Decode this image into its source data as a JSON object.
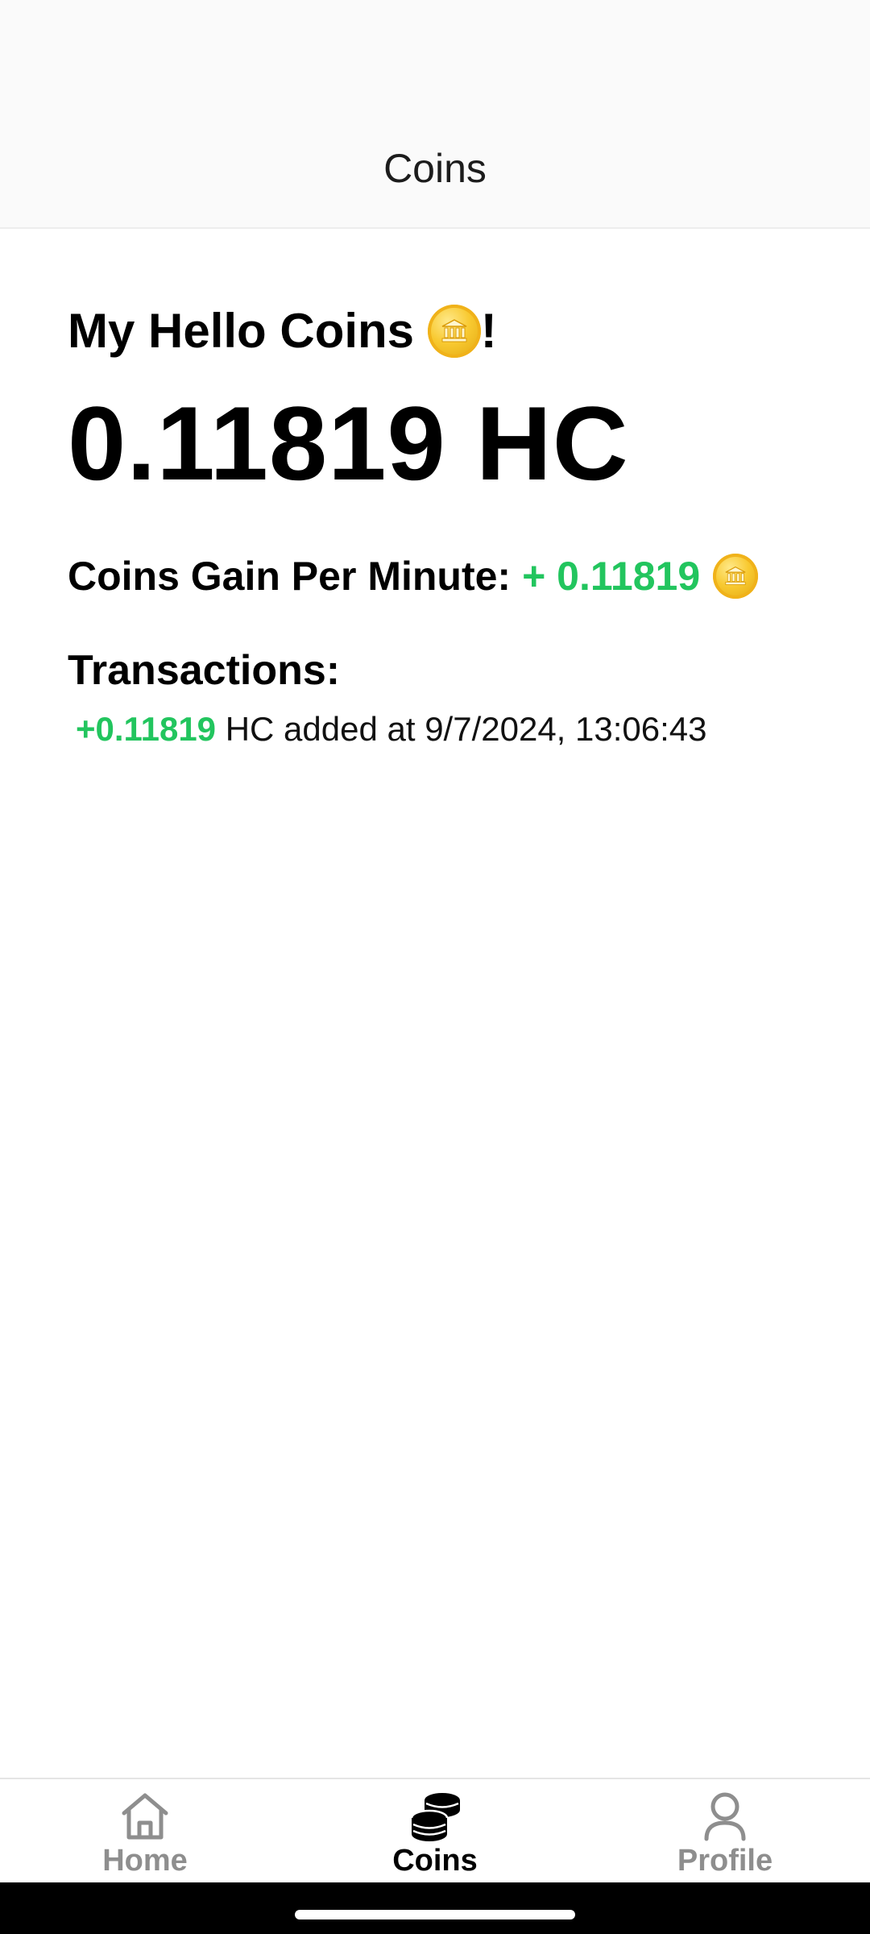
{
  "header": {
    "title": "Coins"
  },
  "main": {
    "heading_text": "My Hello Coins ",
    "heading_suffix": "!",
    "coin_icon": "coin-bank-emoji",
    "balance": "0.11819 HC",
    "gain_label": "Coins Gain Per Minute:",
    "gain_value": "+ 0.11819",
    "transactions_heading": "Transactions:",
    "transactions": [
      {
        "amount": "+0.11819",
        "text": " HC added at 9/7/2024, 13:06:43"
      }
    ]
  },
  "tabbar": {
    "tabs": [
      {
        "label": "Home",
        "icon": "home-icon",
        "active": false
      },
      {
        "label": "Coins",
        "icon": "coins-stack-icon",
        "active": true
      },
      {
        "label": "Profile",
        "icon": "profile-icon",
        "active": false
      }
    ]
  },
  "colors": {
    "accent_green": "#22c55e",
    "inactive_tab": "#8e8e8e",
    "active_tab": "#000000",
    "coin_gold": "#f8c930"
  }
}
